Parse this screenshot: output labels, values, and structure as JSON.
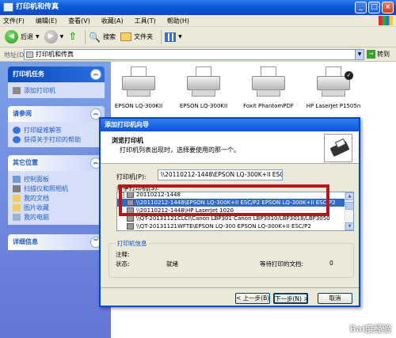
{
  "window": {
    "title": "打印机和传真"
  },
  "menu": [
    "文件(F)",
    "编辑(E)",
    "查看(V)",
    "收藏(A)",
    "工具(T)",
    "帮助(H)"
  ],
  "toolbar": {
    "back": "后退",
    "search": "搜索",
    "folders": "文件夹"
  },
  "address": {
    "label": "地址(D)",
    "value": "打印机和传真",
    "go": "转到"
  },
  "sidebar": {
    "printer_tasks": {
      "title": "打印机任务",
      "items": [
        "添加打印机"
      ]
    },
    "see_also": {
      "title": "请参阅",
      "items": [
        "打印疑难解答",
        "获得关于打印的帮助"
      ]
    },
    "other_places": {
      "title": "其它位置",
      "items": [
        "控制面板",
        "扫描仪和照相机",
        "我的文档",
        "图片收藏",
        "我的电脑"
      ]
    },
    "details": {
      "title": "详细信息"
    }
  },
  "printers": [
    {
      "label": "EPSON LQ-300KII",
      "default": false
    },
    {
      "label": "EPSON LQ-300KII",
      "default": false
    },
    {
      "label": "Foxit PhantomPDF",
      "default": false
    },
    {
      "label": "HP LaserJet P1505n",
      "default": true
    }
  ],
  "dialog": {
    "title": "添加打印机向导",
    "header_title": "浏览打印机",
    "header_desc": "打印机列表出现时，选择要使用的那一个。",
    "printer_label": "打印机(P):",
    "printer_value": "\\\\20110212-1448\\EPSON LQ-300K+II ESC/P2",
    "shared_label": "共享打印机(S):",
    "list": [
      {
        "text": "20110212-1448",
        "selected": false,
        "top_level": true
      },
      {
        "text": "\\\\20110212-1448\\EPSON LQ-300K+II ESC/P2   EPSON LQ-300K+II ESC/P2",
        "selected": true,
        "top_level": false
      },
      {
        "text": "\\\\20110212-1448\\HP LaserJet 1020",
        "selected": false,
        "top_level": false
      },
      {
        "text": "\\\\QT-20131121CLCI\\Canon LBP301   Canon LBP3010/LBP3018/LBP3050",
        "selected": false,
        "top_level": false
      },
      {
        "text": "\\\\QT-20131121WFTE\\EPSON LQ-300   EPSON LQ-300K+II ESC/P2",
        "selected": false,
        "top_level": false
      }
    ],
    "info": {
      "legend": "打印机信息",
      "comment_label": "注释:",
      "status_label": "状态:",
      "status_value": "就绪",
      "docs_label": "等待打印的文档:",
      "docs_value": "0"
    },
    "buttons": {
      "back": "< 上一步(B)",
      "next": "下一步(N) >",
      "cancel": "取消"
    }
  },
  "watermark": "Bai度经验"
}
